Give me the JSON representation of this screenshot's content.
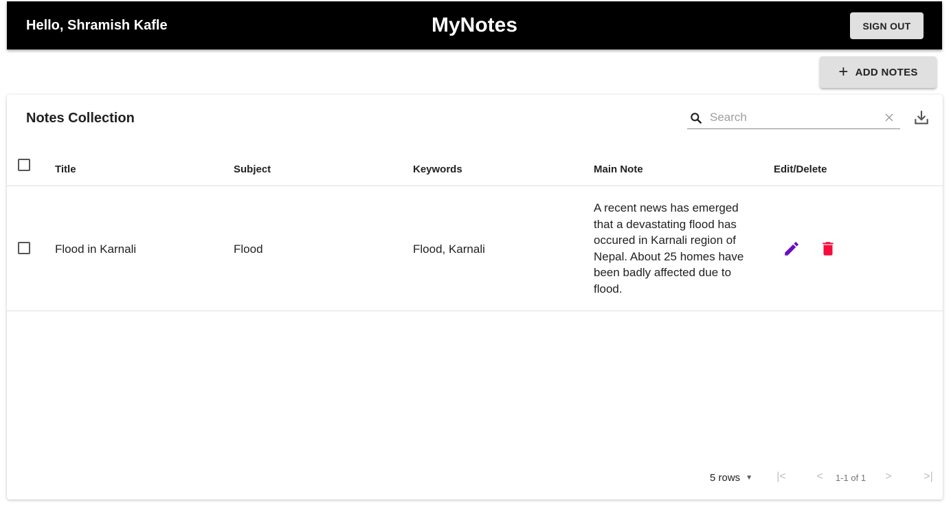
{
  "header": {
    "greeting": "Hello, Shramish Kafle",
    "app_title": "MyNotes",
    "signout_label": "SIGN OUT"
  },
  "toolbar": {
    "add_icon": "plus-icon",
    "add_label": "ADD NOTES"
  },
  "table": {
    "title": "Notes Collection",
    "search": {
      "placeholder": "Search",
      "value": ""
    },
    "columns": [
      "Title",
      "Subject",
      "Keywords",
      "Main Note",
      "Edit/Delete"
    ],
    "rows": [
      {
        "title": "Flood in Karnali",
        "subject": "Flood",
        "keywords": "Flood, Karnali",
        "main_note": "A recent news has emerged that a devastating flood has occured in Karnali region of Nepal. About 25 homes have been badly affected due to flood."
      }
    ],
    "pagination": {
      "rows_per_page": "5 rows",
      "range": "1-1 of 1"
    }
  },
  "colors": {
    "appbar": "#000000",
    "edit_icon": "#6a0dc6",
    "delete_icon": "#f50c3d",
    "button_bg": "#e0e0e0"
  },
  "icons": [
    "search-icon",
    "clear-icon",
    "export-icon",
    "edit-icon",
    "delete-icon",
    "first-page-icon",
    "prev-page-icon",
    "next-page-icon",
    "last-page-icon"
  ]
}
